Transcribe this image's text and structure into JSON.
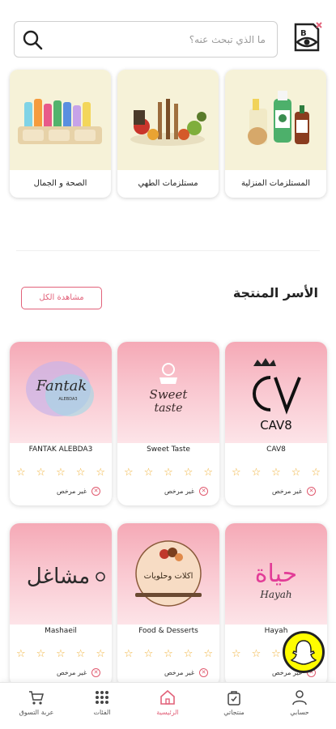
{
  "search": {
    "placeholder": "ما الذي تبحث عنه؟",
    "value": ""
  },
  "categories": [
    {
      "label": "المستلزمات المنزلية",
      "icon": "home-supplies-image"
    },
    {
      "label": "مستلزمات الطهي",
      "icon": "cooking-supplies-image"
    },
    {
      "label": "الصحة و الجمال",
      "icon": "health-beauty-image"
    }
  ],
  "families_section": {
    "title": "الأسر المنتجة",
    "view_all": "مشاهدة الكل"
  },
  "shops": [
    {
      "name": "CAV8",
      "logo_text": "CAV8",
      "rating": 0,
      "license": "غير مرخص"
    },
    {
      "name": "Sweet Taste",
      "logo_text": "Sweet taste",
      "rating": 0,
      "license": "غير مرخص"
    },
    {
      "name": "FANTAK ALEBDA3",
      "logo_text": "Fantak",
      "logo_sub": "ALEBDA3",
      "rating": 0,
      "license": "غير مرخص"
    },
    {
      "name": "Hayah",
      "logo_text": "حياة",
      "logo_sub": "Hayah",
      "rating": 0,
      "license": "غير مرخص"
    },
    {
      "name": "Food & Desserts",
      "logo_text": "اكلات وحلويات",
      "rating": 0,
      "license": "غير مرخص"
    },
    {
      "name": "Mashaeil",
      "logo_text": "مشاغل",
      "rating": 0,
      "license": "غير مرخص"
    }
  ],
  "tabs": [
    {
      "label": "حسابي",
      "icon": "user-icon"
    },
    {
      "label": "منتجاتي",
      "icon": "bag-icon"
    },
    {
      "label": "الرئيسية",
      "icon": "home-icon",
      "active": true
    },
    {
      "label": "الفئات",
      "icon": "grid-icon"
    },
    {
      "label": "عربة التسوق",
      "icon": "cart-icon"
    }
  ],
  "colors": {
    "accent": "#e2627a",
    "star": "#f0b23b",
    "banner_pink": "#f7b6c2",
    "snap": "#fffc00"
  }
}
